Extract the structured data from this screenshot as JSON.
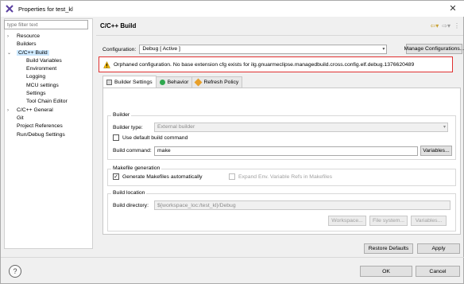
{
  "window": {
    "title": "Properties for test_kl"
  },
  "left": {
    "filter_placeholder": "type filter text",
    "tree": [
      {
        "label": "Resource",
        "level": 0,
        "arrow": "›"
      },
      {
        "label": "Builders",
        "level": 0,
        "arrow": ""
      },
      {
        "label": "C/C++ Build",
        "level": 0,
        "arrow": "⌄",
        "selected": true
      },
      {
        "label": "Build Variables",
        "level": 1
      },
      {
        "label": "Environment",
        "level": 1
      },
      {
        "label": "Logging",
        "level": 1
      },
      {
        "label": "MCU settings",
        "level": 1
      },
      {
        "label": "Settings",
        "level": 1
      },
      {
        "label": "Tool Chain Editor",
        "level": 1
      },
      {
        "label": "C/C++ General",
        "level": 0,
        "arrow": "›"
      },
      {
        "label": "Git",
        "level": 0,
        "arrow": ""
      },
      {
        "label": "Project References",
        "level": 0,
        "arrow": ""
      },
      {
        "label": "Run/Debug Settings",
        "level": 0,
        "arrow": ""
      }
    ]
  },
  "page": {
    "title": "C/C++ Build",
    "configuration_label": "Configuration:",
    "configuration_value": "Debug  [ Active ]",
    "manage_button": "Manage Configurations...",
    "warning": "Orphaned configuration. No base extension cfg exists for ilg.gnuarmeclipse.managedbuild.cross.config.elf.debug.1376620489",
    "tabs": [
      "Builder Settings",
      "Behavior",
      "Refresh Policy"
    ],
    "builder": {
      "group_title": "Builder",
      "type_label": "Builder type:",
      "type_value": "External builder",
      "use_default_label": "Use default build command",
      "command_label": "Build command:",
      "command_value": "make",
      "variables_button": "Variables..."
    },
    "makefile": {
      "group_title": "Makefile generation",
      "generate_label": "Generate Makefiles automatically",
      "expand_label": "Expand Env. Variable Refs in Makefiles"
    },
    "location": {
      "group_title": "Build location",
      "dir_label": "Build directory:",
      "dir_value": "${workspace_loc:/test_kl}/Debug",
      "workspace_button": "Workspace...",
      "filesystem_button": "File system...",
      "variables_button": "Variables..."
    },
    "restore_button": "Restore Defaults",
    "apply_button": "Apply"
  },
  "footer": {
    "ok_button": "OK",
    "cancel_button": "Cancel"
  },
  "colors": {
    "selection": "#cce8ff",
    "warning_border": "#e03030",
    "warning_icon": "#f0b400"
  }
}
